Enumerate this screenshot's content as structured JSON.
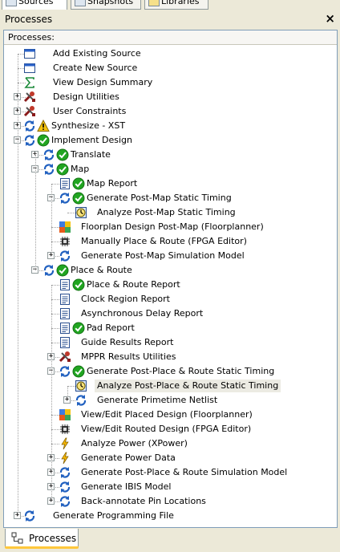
{
  "top_tabs": [
    "Sources",
    "Snapshots",
    "Libraries"
  ],
  "window": {
    "title": "Processes",
    "close_glyph": "×"
  },
  "panel": {
    "header": "Processes:"
  },
  "tree": [
    {
      "label": "Add Existing Source",
      "depth": 1,
      "icons": [
        "window-icon"
      ],
      "has_children": false,
      "expanded": false
    },
    {
      "label": "Create New Source",
      "depth": 1,
      "icons": [
        "window-icon"
      ],
      "has_children": false,
      "expanded": false
    },
    {
      "label": "View Design Summary",
      "depth": 1,
      "icons": [
        "sigma-icon"
      ],
      "has_children": false,
      "expanded": false
    },
    {
      "label": "Design Utilities",
      "depth": 1,
      "icons": [
        "tools-icon"
      ],
      "has_children": true,
      "expanded": false
    },
    {
      "label": "User Constraints",
      "depth": 1,
      "icons": [
        "tools-icon"
      ],
      "has_children": true,
      "expanded": false
    },
    {
      "label": "Synthesize - XST",
      "depth": 1,
      "icons": [
        "process-icon",
        "warning-icon"
      ],
      "has_children": true,
      "expanded": false
    },
    {
      "label": "Implement Design",
      "depth": 1,
      "icons": [
        "process-icon",
        "check-icon"
      ],
      "has_children": true,
      "expanded": true
    },
    {
      "label": "Translate",
      "depth": 2,
      "icons": [
        "process-icon",
        "check-icon"
      ],
      "has_children": true,
      "expanded": false
    },
    {
      "label": "Map",
      "depth": 2,
      "icons": [
        "process-icon",
        "check-icon"
      ],
      "has_children": true,
      "expanded": true
    },
    {
      "label": "Map Report",
      "depth": 3,
      "icons": [
        "report-icon",
        "check-icon"
      ],
      "has_children": false,
      "expanded": false
    },
    {
      "label": "Generate Post-Map Static Timing",
      "depth": 3,
      "icons": [
        "process-icon",
        "check-icon"
      ],
      "has_children": true,
      "expanded": true
    },
    {
      "label": "Analyze Post-Map Static Timing",
      "depth": 4,
      "icons": [
        "timing-icon"
      ],
      "has_children": false,
      "expanded": false
    },
    {
      "label": "Floorplan Design Post-Map (Floorplanner)",
      "depth": 3,
      "icons": [
        "floorplan-icon"
      ],
      "has_children": false,
      "expanded": false
    },
    {
      "label": "Manually Place & Route (FPGA Editor)",
      "depth": 3,
      "icons": [
        "chip-icon"
      ],
      "has_children": false,
      "expanded": false
    },
    {
      "label": "Generate Post-Map Simulation Model",
      "depth": 3,
      "icons": [
        "process-icon"
      ],
      "has_children": true,
      "expanded": false
    },
    {
      "label": "Place & Route",
      "depth": 2,
      "icons": [
        "process-icon",
        "check-icon"
      ],
      "has_children": true,
      "expanded": true
    },
    {
      "label": "Place & Route Report",
      "depth": 3,
      "icons": [
        "report-icon",
        "check-icon"
      ],
      "has_children": false,
      "expanded": false
    },
    {
      "label": "Clock Region Report",
      "depth": 3,
      "icons": [
        "report-icon"
      ],
      "has_children": false,
      "expanded": false
    },
    {
      "label": "Asynchronous Delay Report",
      "depth": 3,
      "icons": [
        "report-icon"
      ],
      "has_children": false,
      "expanded": false
    },
    {
      "label": "Pad Report",
      "depth": 3,
      "icons": [
        "report-icon",
        "check-icon"
      ],
      "has_children": false,
      "expanded": false
    },
    {
      "label": "Guide Results Report",
      "depth": 3,
      "icons": [
        "report-icon"
      ],
      "has_children": false,
      "expanded": false
    },
    {
      "label": "MPPR Results Utilities",
      "depth": 3,
      "icons": [
        "tools-icon"
      ],
      "has_children": true,
      "expanded": false
    },
    {
      "label": "Generate Post-Place & Route Static Timing",
      "depth": 3,
      "icons": [
        "process-icon",
        "check-icon"
      ],
      "has_children": true,
      "expanded": true
    },
    {
      "label": "Analyze Post-Place & Route Static Timing",
      "depth": 4,
      "icons": [
        "timing-icon"
      ],
      "has_children": false,
      "expanded": false,
      "selected": true
    },
    {
      "label": "Generate Primetime Netlist",
      "depth": 4,
      "icons": [
        "process-icon"
      ],
      "has_children": true,
      "expanded": false
    },
    {
      "label": "View/Edit Placed Design (Floorplanner)",
      "depth": 3,
      "icons": [
        "floorplan-icon"
      ],
      "has_children": false,
      "expanded": false
    },
    {
      "label": "View/Edit Routed Design (FPGA Editor)",
      "depth": 3,
      "icons": [
        "chip-icon"
      ],
      "has_children": false,
      "expanded": false
    },
    {
      "label": "Analyze Power (XPower)",
      "depth": 3,
      "icons": [
        "power-icon"
      ],
      "has_children": false,
      "expanded": false
    },
    {
      "label": "Generate Power Data",
      "depth": 3,
      "icons": [
        "power-icon"
      ],
      "has_children": true,
      "expanded": false
    },
    {
      "label": "Generate Post-Place & Route Simulation Model",
      "depth": 3,
      "icons": [
        "process-icon"
      ],
      "has_children": true,
      "expanded": false
    },
    {
      "label": "Generate IBIS Model",
      "depth": 3,
      "icons": [
        "process-icon"
      ],
      "has_children": true,
      "expanded": false
    },
    {
      "label": "Back-annotate Pin Locations",
      "depth": 3,
      "icons": [
        "process-icon"
      ],
      "has_children": true,
      "expanded": false
    },
    {
      "label": "Generate Programming File",
      "depth": 1,
      "icons": [
        "process-icon"
      ],
      "has_children": true,
      "expanded": false
    }
  ],
  "bottom_tab": {
    "label": "Processes",
    "icon": "processes-tab-icon"
  },
  "colors": {
    "check_green": "#21a521",
    "process_blue": "#1f5fbf",
    "warning_yellow": "#f4c20d",
    "selection": "#ecebe3"
  }
}
